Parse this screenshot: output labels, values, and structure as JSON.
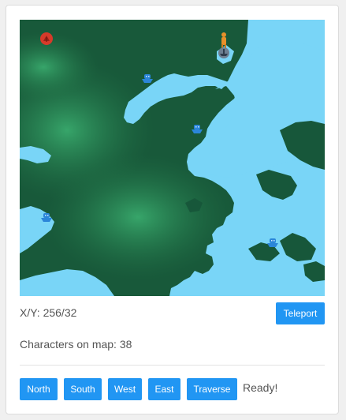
{
  "map": {
    "water_color": "#79d5f7",
    "land_color": "#1f6e43",
    "markers": [
      {
        "name": "player-red-marker-icon",
        "color": "#d63a2a"
      },
      {
        "name": "npc-orange-figure-icon",
        "color": "#e8902a"
      },
      {
        "name": "grey-ship-icon",
        "color": "#6d7f91"
      },
      {
        "name": "blue-ship-icon",
        "color": "#2b86d9"
      }
    ]
  },
  "position": {
    "text": "X/Y: 256/32"
  },
  "teleport_label": "Teleport",
  "characters_text": "Characters on map: 38",
  "directions": [
    {
      "label": "North"
    },
    {
      "label": "South"
    },
    {
      "label": "West"
    },
    {
      "label": "East"
    },
    {
      "label": "Traverse"
    }
  ],
  "status_text": "Ready!",
  "accent_color": "#2196f3"
}
